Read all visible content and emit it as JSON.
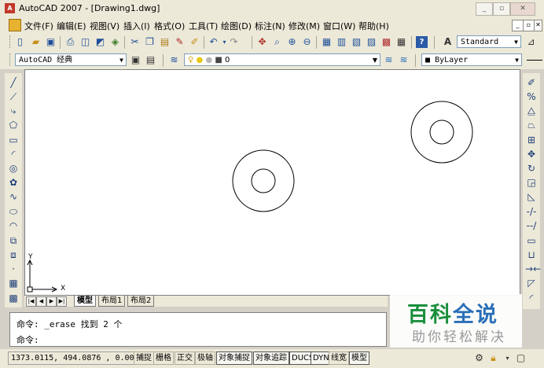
{
  "window": {
    "title": "AutoCAD 2007 - [Drawing1.dwg]",
    "min_label": "_",
    "max_label": "▫",
    "close_label": "✕"
  },
  "menu": {
    "items": [
      "文件(F)",
      "编辑(E)",
      "视图(V)",
      "插入(I)",
      "格式(O)",
      "工具(T)",
      "绘图(D)",
      "标注(N)",
      "修改(M)",
      "窗口(W)",
      "帮助(H)"
    ],
    "doc_min": "_",
    "doc_restore": "▫",
    "doc_close": "✕"
  },
  "toolbar": {
    "text_style": "Standard",
    "workspace": "AutoCAD 经典",
    "layer": "0",
    "color": "ByLayer"
  },
  "ucs": {
    "y_label": "Y",
    "x_label": "X"
  },
  "tabs": [
    {
      "label": "模型",
      "active": true
    },
    {
      "label": "布局1",
      "active": false
    },
    {
      "label": "布局2",
      "active": false
    }
  ],
  "command": {
    "line1": "命令: _erase 找到 2 个",
    "line2": "命令:"
  },
  "status": {
    "coords": "1373.0115, 494.0876 , 0.0000",
    "buttons": [
      {
        "label": "捕捉",
        "on": false
      },
      {
        "label": "栅格",
        "on": false
      },
      {
        "label": "正交",
        "on": false
      },
      {
        "label": "极轴",
        "on": false
      },
      {
        "label": "对象捕捉",
        "on": true
      },
      {
        "label": "对象追踪",
        "on": true
      },
      {
        "label": "DUCS",
        "on": true
      },
      {
        "label": "DYN",
        "on": true
      },
      {
        "label": "线宽",
        "on": false
      },
      {
        "label": "模型",
        "on": true
      }
    ]
  },
  "watermark": {
    "title": "百科全说",
    "subtitle": "助你轻松解决",
    "colors": {
      "bai": "#1a8f3c",
      "ke": "#1a8f3c",
      "quan": "#2a6fb8",
      "shuo": "#2a6fb8"
    }
  },
  "icons": {
    "standard_toolbar": [
      "new-icon",
      "open-icon",
      "save-icon",
      "plot-icon",
      "preview-icon",
      "publish-icon",
      "cut-icon",
      "copy-icon",
      "paste-icon",
      "matchprop-icon",
      "undo-icon",
      "redo-icon",
      "pan-icon",
      "zoom-realtime-icon",
      "zoom-window-icon",
      "zoom-previous-icon",
      "properties-icon",
      "designcenter-icon",
      "toolpalettes-icon",
      "sheetset-icon",
      "markup-icon",
      "calculator-icon",
      "help-icon"
    ],
    "draw_toolbar": [
      "line-icon",
      "construction-line-icon",
      "polyline-icon",
      "polygon-icon",
      "rectangle-icon",
      "arc-icon",
      "circle-icon",
      "revcloud-icon",
      "spline-icon",
      "ellipse-icon",
      "ellipse-arc-icon",
      "insert-block-icon",
      "make-block-icon",
      "point-icon",
      "hatch-icon",
      "gradient-icon"
    ],
    "modify_toolbar": [
      "erase-icon",
      "copy-object-icon",
      "mirror-icon",
      "offset-icon",
      "array-icon",
      "move-icon",
      "rotate-icon",
      "scale-icon",
      "stretch-icon",
      "trim-icon",
      "extend-icon",
      "break-point-icon",
      "break-icon",
      "join-icon",
      "chamfer-icon",
      "fillet-icon"
    ]
  }
}
